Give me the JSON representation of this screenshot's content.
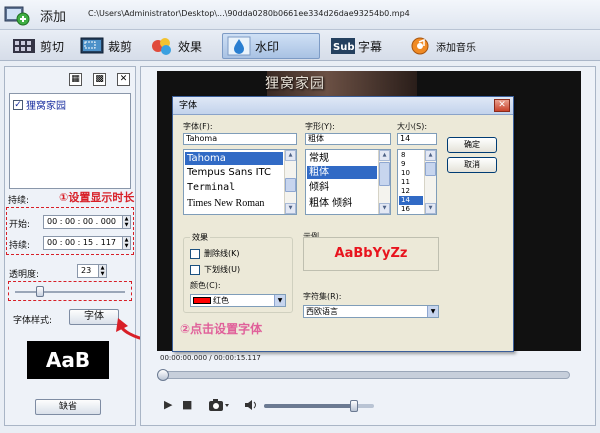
{
  "topbar": {
    "add_label": "添加",
    "file_path": "C:\\Users\\Administrator\\Desktop\\...\\90dda0280b0661ee334d26dae93254b0.mp4"
  },
  "tabs": [
    {
      "label": "剪切"
    },
    {
      "label": "裁剪"
    },
    {
      "label": "效果"
    },
    {
      "label": "水印"
    },
    {
      "label": "字幕"
    },
    {
      "label": "添加音乐"
    }
  ],
  "left": {
    "mini_icons": [
      "▦",
      "▩",
      "✕"
    ],
    "watermark_item": "狸窝家园",
    "duration_label": "持续:",
    "start_label": "开始:",
    "start_value": "00 : 00 : 00 . 000",
    "duration2_label": "持续:",
    "duration_value": "00 : 00 : 15 . 117",
    "opacity_label": "透明度:",
    "opacity_value": "23",
    "opacity_percent": 23,
    "font_style_label": "字体样式:",
    "font_button": "字体",
    "preview_text": "AaB",
    "default_button": "缺省"
  },
  "annotations": {
    "step1": "①设置显示时长",
    "step2": "②点击设置字体"
  },
  "video": {
    "watermark": "狸窝家园",
    "timecode": "00:00:00.000 / 00:00:15.117",
    "volume_percent": 82
  },
  "font_dialog": {
    "title": "字体",
    "close": "✕",
    "font_label": "字体(F):",
    "font_value": "Tahoma",
    "font_list": [
      "Tahoma",
      "Tempus Sans ITC",
      "Terminal",
      "Times New Roman"
    ],
    "style_label": "字形(Y):",
    "style_value": "粗体",
    "style_list": [
      "常规",
      "粗体",
      "倾斜",
      "粗体 倾斜"
    ],
    "size_label": "大小(S):",
    "size_value": "14",
    "size_list": [
      "8",
      "9",
      "10",
      "11",
      "12",
      "14",
      "16"
    ],
    "ok": "确定",
    "cancel": "取消",
    "effects_label": "效果",
    "strikeout": "删除线(K)",
    "underline": "下划线(U)",
    "color_label": "颜色(C):",
    "color_value": "红色",
    "sample_label": "示例",
    "sample_text": "AaBbYyZz",
    "charset_label": "字符集(R):",
    "charset_value": "西欧语言"
  },
  "colors": {
    "accent": "#316ac5",
    "annotation_red": "#d81f27",
    "annotation_pink": "#e0609a",
    "sample_red": "#e8141e"
  }
}
